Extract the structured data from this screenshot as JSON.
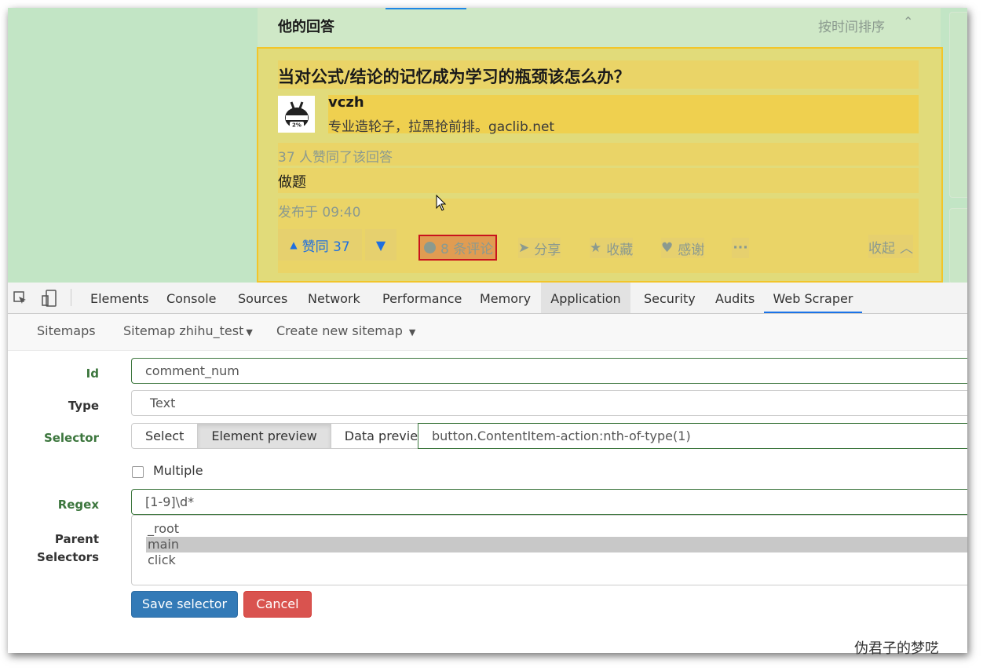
{
  "page": {
    "section_title": "他的回答",
    "sort_label": "按时间排序",
    "question_title": "当对公式/结论的记忆成为学习的瓶颈该怎么办？",
    "author_name": "vczh",
    "author_bio": "专业造轮子，拉黑抢前排。gaclib.net",
    "avatar_text": "2%",
    "voters_text": "37 人赞同了该回答",
    "answer_text": "做题",
    "publish_time": "发布于 09:40",
    "actions": {
      "upvote": "赞同 37",
      "comments": "8 条评论",
      "share": "分享",
      "collect": "收藏",
      "thanks": "感谢",
      "more": "···",
      "collapse": "收起"
    }
  },
  "devtools": {
    "tabs": [
      "Elements",
      "Console",
      "Sources",
      "Network",
      "Performance",
      "Memory",
      "Application",
      "Security",
      "Audits",
      "Web Scraper"
    ],
    "active_tab": "Web Scraper",
    "highlighted_tab": "Application",
    "subnav": {
      "sitemaps": "Sitemaps",
      "sitemap_current": "Sitemap zhihu_test",
      "create_new": "Create new sitemap"
    },
    "form": {
      "id_label": "Id",
      "id_value": "comment_num",
      "type_label": "Type",
      "type_value": "Text",
      "selector_label": "Selector",
      "select_button": "Select",
      "element_preview_button": "Element preview",
      "data_preview_button": "Data preview",
      "selector_value": "button.ContentItem-action:nth-of-type(1)",
      "multiple_label": "Multiple",
      "multiple_checked": false,
      "regex_label": "Regex",
      "regex_value": "[1-9]\\d*",
      "parent_label_line1": "Parent",
      "parent_label_line2": "Selectors",
      "parent_options": [
        "_root",
        "main",
        "click"
      ],
      "parent_selected": "main",
      "save_button": "Save selector",
      "cancel_button": "Cancel"
    }
  },
  "watermark": "伪君子的梦呓",
  "colors": {
    "page_bg": "#c2e5c5",
    "highlight": "#ead467",
    "zhihu_blue": "#1e6fe0",
    "selected_outline": "#c9141d",
    "save_blue": "#337ab7",
    "cancel_red": "#d9534f",
    "label_green": "#3c763d"
  }
}
